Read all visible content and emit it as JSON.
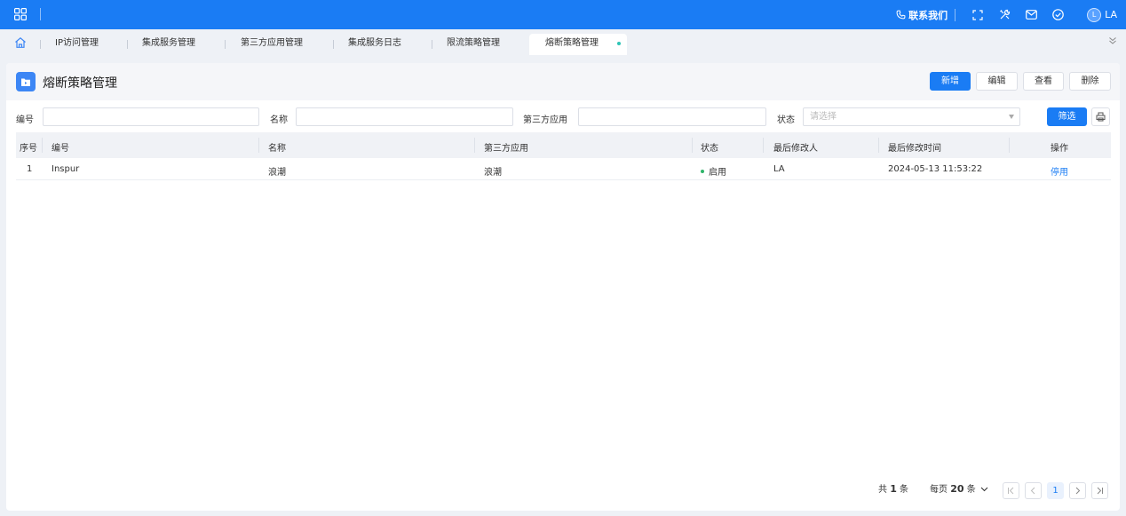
{
  "topbar": {
    "contact_label": "联系我们",
    "avatar_initial": "L",
    "username": "LA"
  },
  "tabs": [
    {
      "label": "IP访问管理"
    },
    {
      "label": "集成服务管理"
    },
    {
      "label": "第三方应用管理"
    },
    {
      "label": "集成服务日志"
    },
    {
      "label": "限流策略管理"
    },
    {
      "label": "熔断策略管理",
      "active": true
    }
  ],
  "page": {
    "title": "熔断策略管理",
    "buttons": {
      "add": "新增",
      "edit": "编辑",
      "view": "查看",
      "delete": "删除"
    }
  },
  "filters": {
    "code_label": "编号",
    "name_label": "名称",
    "app_label": "第三方应用",
    "status_label": "状态",
    "status_placeholder": "请选择",
    "filter_button": "筛选"
  },
  "table": {
    "columns": [
      "序号",
      "编号",
      "名称",
      "第三方应用",
      "状态",
      "最后修改人",
      "最后修改时间",
      "操作"
    ],
    "rows": [
      {
        "index": "1",
        "code": "Inspur",
        "name": "浪潮",
        "app": "浪潮",
        "status": "启用",
        "modifier": "LA",
        "time": "2024-05-13 11:53:22",
        "action": "停用"
      }
    ]
  },
  "pagination": {
    "total_prefix": "共",
    "total_count": "1",
    "total_suffix": "条",
    "per_page_prefix": "每页",
    "per_page_value": "20",
    "per_page_suffix": "条",
    "current_page": "1"
  },
  "colors": {
    "primary": "#1a7cf4",
    "status_on": "#2fb56a",
    "tab_dot": "#2ec4b6"
  }
}
